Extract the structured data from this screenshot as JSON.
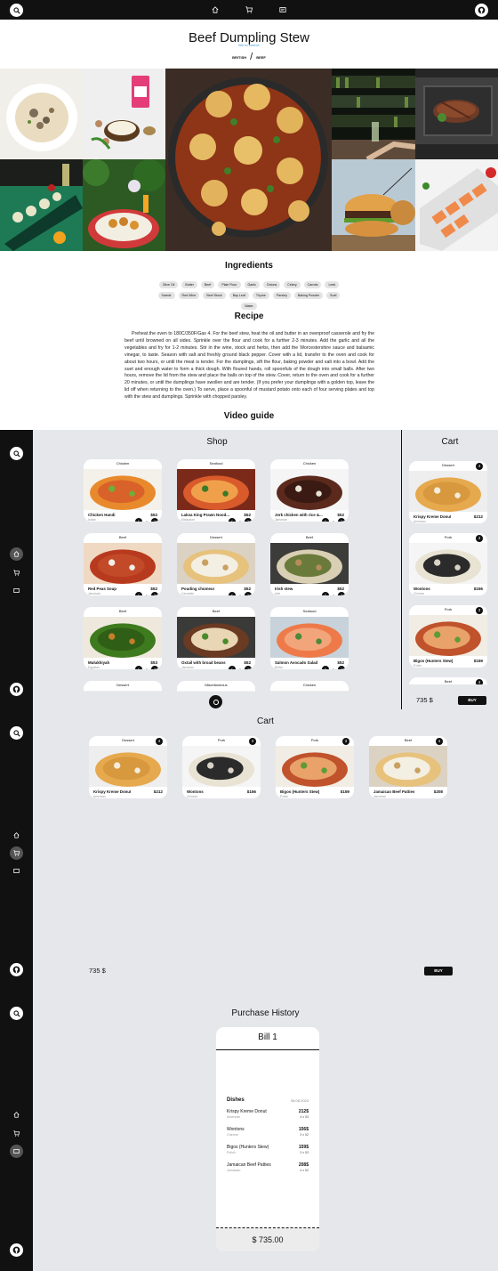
{
  "nav": {
    "icons": [
      "search-icon",
      "home-icon",
      "cart-icon",
      "history-icon",
      "github-icon"
    ]
  },
  "meal": {
    "title": "Beef Dumpling Stew",
    "source_link": "link to source",
    "area": "BRITISH",
    "category": "BEEF"
  },
  "ingredients": {
    "heading": "Ingredients",
    "items": [
      "Olive Oil",
      "Butter",
      "Beef",
      "Plain Flour",
      "Garlic",
      "Onions",
      "Celery",
      "Carrots",
      "Leek",
      "Swede",
      "Red Wine",
      "Beef Stock",
      "Bay Leaf",
      "Thyme",
      "Parsley",
      "Baking Powder",
      "Suet",
      "Water"
    ]
  },
  "recipe": {
    "heading": "Recipe",
    "text": "Preheat the oven to 180C/350F/Gas 4. For the beef stew, heat the oil and butter in an ovenproof casserole and fry the beef until browned on all sides. Sprinkle over the flour and cook for a further 2-3 minutes. Add the garlic and all the vegetables and fry for 1-2 minutes. Stir in the wine, stock and herbs, then add the Worcestershire sauce and balsamic vinegar, to taste. Season with salt and freshly ground black pepper. Cover with a lid, transfer to the oven and cook for about two hours, or until the meat is tender. For the dumplings, sift the flour, baking powder and salt into a bowl. Add the suet and enough water to form a thick dough. With floured hands, roll spoonfuls of the dough into small balls. After two hours, remove the lid from the stew and place the balls on top of the stew. Cover, return to the oven and cook for a further 20 minutes, or until the dumplings have swollen and are tender. (If you prefer your dumplings with a golden top, leave the lid off when returning to the oven.) To serve, place a spoonful of mustard potato onto each of four serving plates and top with the stew and dumplings. Sprinkle with chopped parsley."
  },
  "video": {
    "heading": "Video guide"
  },
  "shop": {
    "heading": "Shop",
    "products": [
      {
        "category": "Chicken",
        "name": "Chicken Handi",
        "price": "$52",
        "area": "Indian",
        "qty": "0"
      },
      {
        "category": "Seafood",
        "name": "Laksa King Prawn Nood...",
        "price": "$52",
        "area": "Malaysian",
        "qty": "0"
      },
      {
        "category": "Chicken",
        "name": "Jerk chicken with rice &...",
        "price": "$52",
        "area": "Jamaican",
        "qty": "0"
      },
      {
        "category": "Beef",
        "name": "Red Peas Soup",
        "price": "$52",
        "area": "Jamaican",
        "qty": "0"
      },
      {
        "category": "Dessert",
        "name": "Pouding chomeur",
        "price": "$52",
        "area": "Canadian",
        "qty": "0"
      },
      {
        "category": "Beef",
        "name": "Irish stew",
        "price": "$52",
        "area": "Irish",
        "qty": "0"
      },
      {
        "category": "Beef",
        "name": "Mulukhiyah",
        "price": "$53",
        "area": "Egyptian",
        "qty": "0"
      },
      {
        "category": "Beef",
        "name": "Oxtail with broad beans",
        "price": "$52",
        "area": "Jamaican",
        "qty": "0"
      },
      {
        "category": "Seafood",
        "name": "Salmon Avocado Salad",
        "price": "$52",
        "area": "British",
        "qty": "0"
      },
      {
        "category": "Dessert",
        "name": "",
        "price": "",
        "area": "",
        "qty": ""
      },
      {
        "category": "Miscellaneous",
        "name": "",
        "price": "",
        "area": "",
        "qty": ""
      },
      {
        "category": "Chicken",
        "name": "",
        "price": "",
        "area": "",
        "qty": ""
      }
    ]
  },
  "cart": {
    "heading": "Cart",
    "items": [
      {
        "category": "Dessert",
        "name": "Krispy Kreme Donut",
        "price": "$212",
        "area": "American",
        "count": "4"
      },
      {
        "category": "Pork",
        "name": "Wontons",
        "price": "$156",
        "area": "Chinese",
        "count": "3"
      },
      {
        "category": "Pork",
        "name": "Bigos (Hunters Stew)",
        "price": "$159",
        "area": "Polish",
        "count": "3"
      },
      {
        "category": "Beef",
        "name": "Jamaican Beef Patties",
        "price": "$208",
        "area": "Jamaican",
        "count": "4"
      }
    ],
    "total": "735 $",
    "buy_label": "BUY"
  },
  "history": {
    "heading": "Purchase History",
    "bill_title": "Bill 1",
    "dishes_label": "Dishes",
    "date": "08.08.2023",
    "lines": [
      {
        "name": "Krispy Kreme Donut",
        "area": "American",
        "price": "212$",
        "qty": "4 x 53"
      },
      {
        "name": "Wontons",
        "area": "Chinese",
        "price": "156$",
        "qty": "3 x 52"
      },
      {
        "name": "Bigos (Hunters Stew)",
        "area": "Polish",
        "price": "159$",
        "qty": "3 x 53"
      },
      {
        "name": "Jamaican Beef Patties",
        "area": "Jamaican",
        "price": "208$",
        "qty": "4 x 52"
      }
    ],
    "total": "$ 735.00"
  }
}
